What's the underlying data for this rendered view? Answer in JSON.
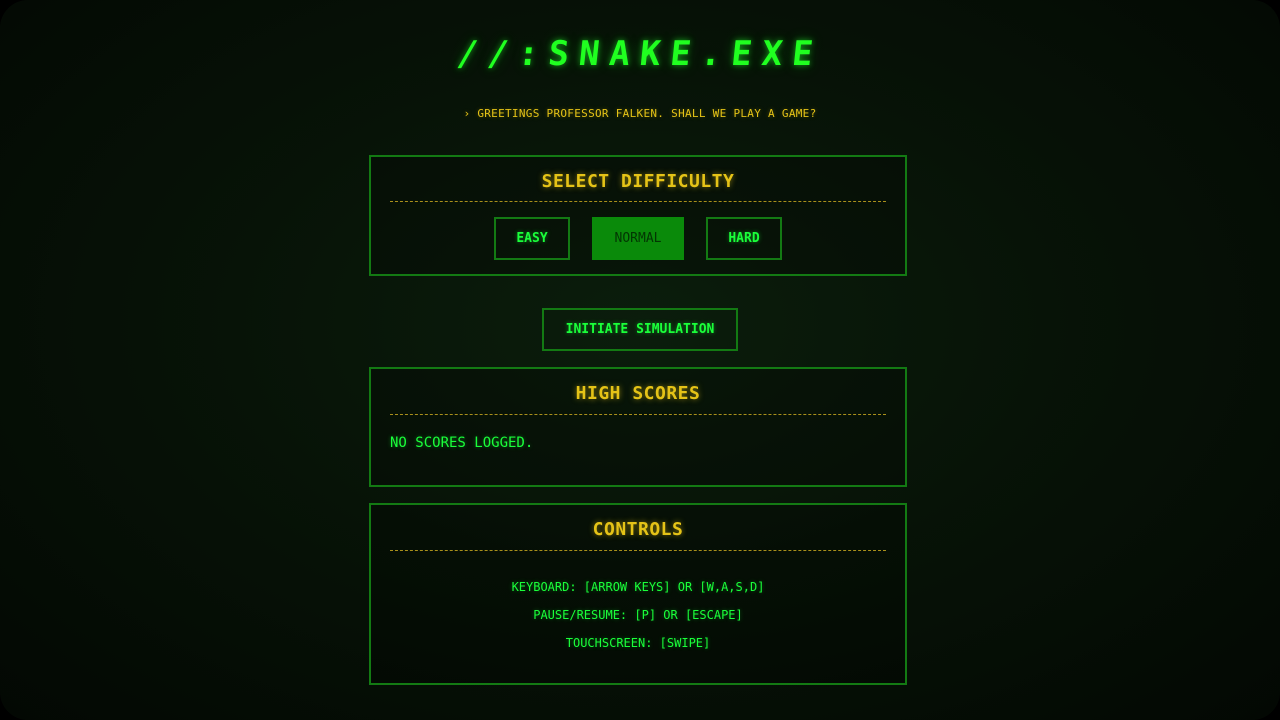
{
  "title": "//:SNAKE.EXE",
  "greeting": "› GREETINGS PROFESSOR FALKEN. SHALL WE PLAY A GAME?",
  "difficulty": {
    "heading": "SELECT DIFFICULTY",
    "options": [
      "EASY",
      "NORMAL",
      "HARD"
    ],
    "selected": "NORMAL"
  },
  "start_button": "INITIATE SIMULATION",
  "high_scores": {
    "heading": "HIGH SCORES",
    "empty_text": "NO SCORES LOGGED."
  },
  "controls": {
    "heading": "CONTROLS",
    "lines": [
      "KEYBOARD: [ARROW KEYS] OR [W,A,S,D]",
      "PAUSE/RESUME: [P] OR [ESCAPE]",
      "TOUCHSCREEN: [SWIPE]"
    ]
  },
  "colors": {
    "background": "#071307",
    "primary_green": "#1aff3a",
    "accent_yellow": "#e5c317",
    "border_green": "#137a13",
    "selected_fill": "#0a8a0a"
  }
}
